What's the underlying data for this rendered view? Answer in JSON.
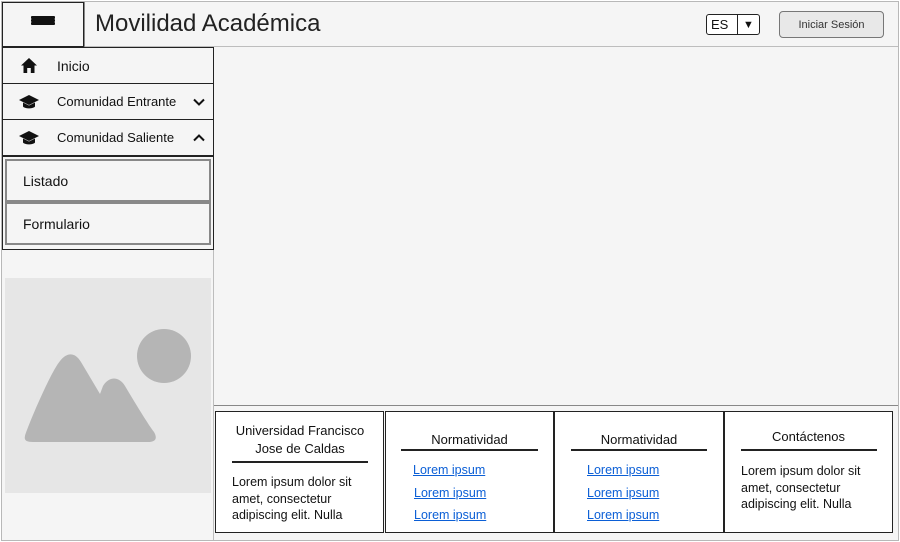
{
  "header": {
    "title": "Movilidad Académica",
    "menu_icon": "hamburger-icon",
    "language": {
      "selected": "ES",
      "arrow": "▼"
    },
    "login_label": "Iniciar Sesión"
  },
  "sidebar": {
    "items": [
      {
        "label": "Inicio",
        "icon": "home-icon"
      },
      {
        "label": "Comunidad Entrante",
        "icon": "graduation-cap-icon",
        "chevron": "chevron-down-icon"
      },
      {
        "label": "Comunidad Saliente",
        "icon": "graduation-cap-icon",
        "chevron": "chevron-up-icon"
      }
    ],
    "submenu": [
      {
        "label": "Listado"
      },
      {
        "label": "Formulario"
      }
    ],
    "image_placeholder": "image-icon"
  },
  "footer": {
    "columns": [
      {
        "title": "Universidad Francisco Jose de Caldas",
        "text": "Lorem ipsum dolor sit amet, consectetur adipiscing elit. Nulla"
      },
      {
        "title": "Normatividad",
        "links": [
          "Lorem ipsum",
          "Lorem ipsum",
          "Lorem ipsum"
        ]
      },
      {
        "title": "Normatividad",
        "links": [
          "Lorem ipsum",
          "Lorem ipsum",
          "Lorem ipsum"
        ]
      },
      {
        "title": "Contáctenos",
        "text": "Lorem ipsum dolor sit amet, consectetur adipiscing elit. Nulla"
      }
    ]
  },
  "colors": {
    "background": "#f5f5f5",
    "border": "#222222",
    "link": "#0b5fd6",
    "placeholder": "#e6e6e6",
    "placeholder_shape": "#b5b5b5"
  }
}
